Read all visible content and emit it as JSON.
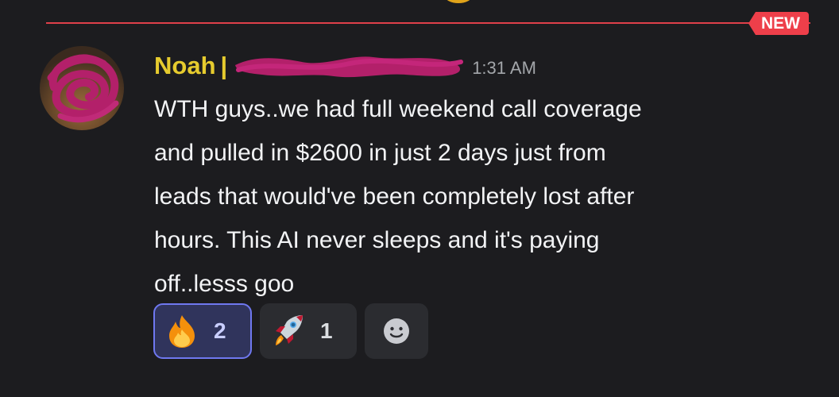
{
  "divider": {
    "badge_label": "NEW",
    "color": "#ee3f4a"
  },
  "message": {
    "author": "Noah",
    "author_separator": "|",
    "author_color": "#e6cb2e",
    "author_suffix_redacted": true,
    "timestamp": "1:31 AM",
    "lines": [
      "WTH guys..we had full weekend call coverage",
      "and pulled in $2600 in just 2 days just from",
      "leads that would've been completely lost after",
      "hours. This AI never sleeps and it's paying",
      "off..lesss goo"
    ]
  },
  "reactions": [
    {
      "emoji": "fire-emoji",
      "count": "2",
      "selected": true
    },
    {
      "emoji": "rocket-emoji",
      "count": "1",
      "selected": false
    },
    {
      "emoji": "add-reaction-icon",
      "count": "",
      "selected": false
    }
  ],
  "colors": {
    "background": "#1c1c1f",
    "selected_reaction_border": "#6f78f0",
    "redaction": "#b3206a"
  }
}
